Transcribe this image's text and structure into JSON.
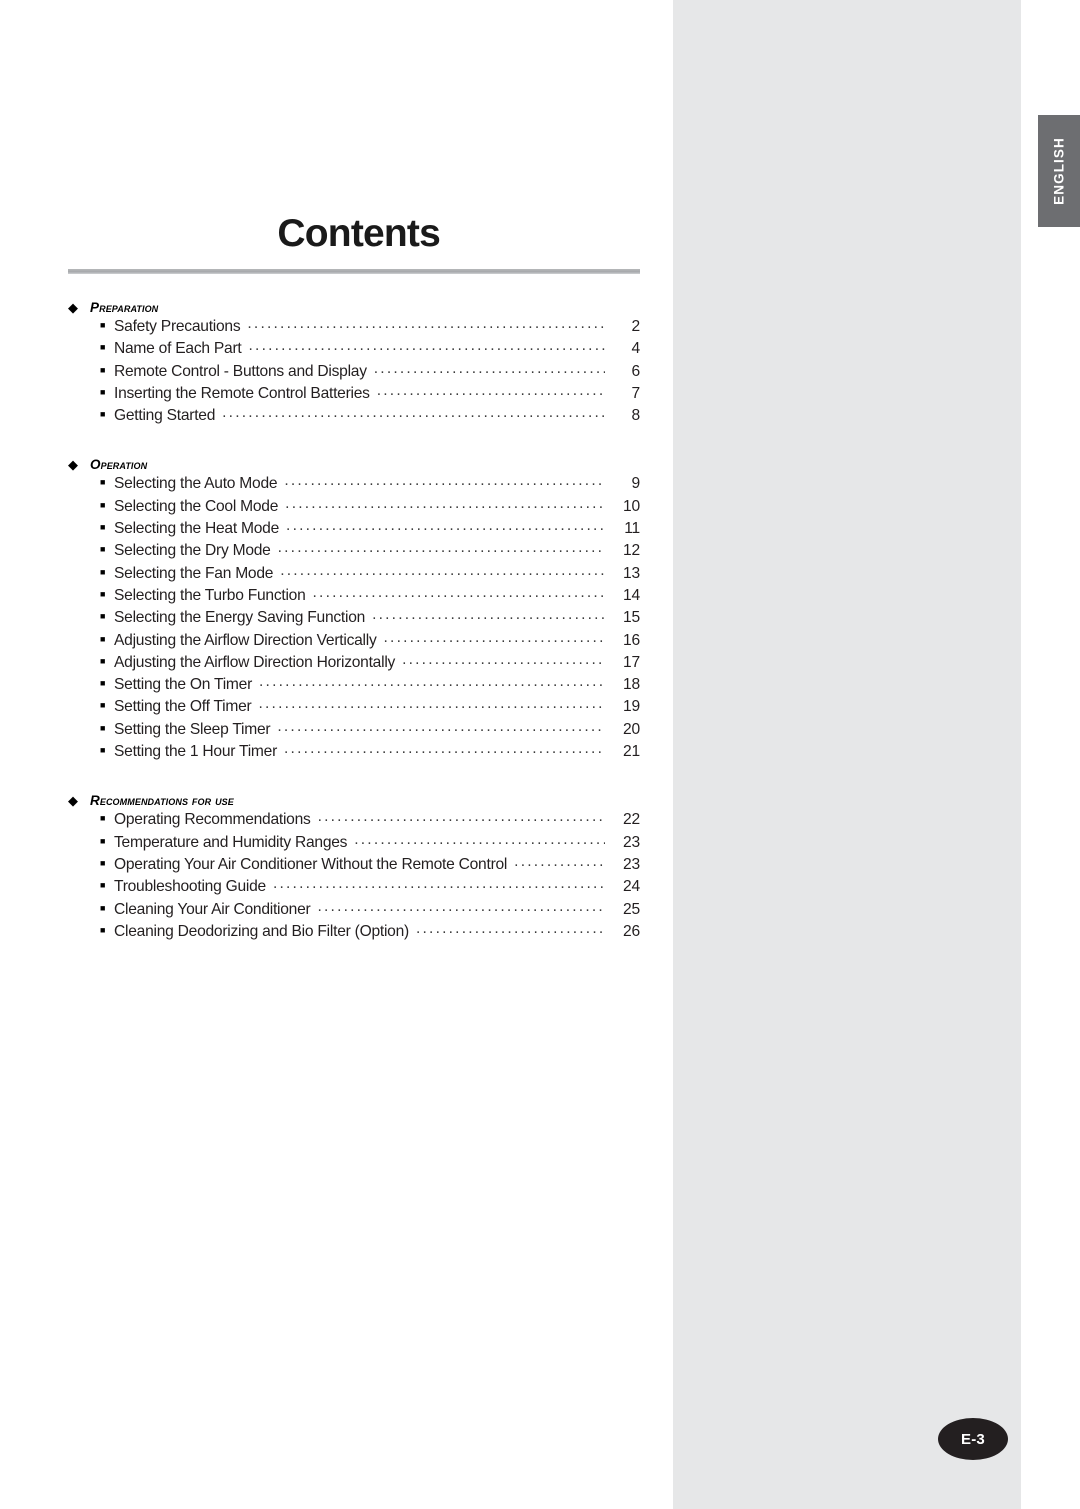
{
  "page": {
    "title": "Contents",
    "language_tab": "ENGLISH",
    "page_badge": "E-3",
    "page_badge_prefix": "E-",
    "page_badge_number": "3"
  },
  "colors": {
    "panel_gray": "#e6e7e8",
    "tab_gray": "#6d6e71",
    "badge_dark": "#231f20",
    "rule_gray": "#a7a9ac",
    "text": "#231f20"
  },
  "icons": {
    "section_bullet": "◆",
    "item_bullet": "■"
  },
  "sections": [
    {
      "heading": "Preparation",
      "items": [
        {
          "label": "Safety Precautions",
          "page": "2"
        },
        {
          "label": "Name of Each Part",
          "page": "4"
        },
        {
          "label": "Remote Control - Buttons and Display",
          "page": "6"
        },
        {
          "label": "Inserting the Remote Control Batteries",
          "page": "7"
        },
        {
          "label": "Getting Started",
          "page": "8"
        }
      ]
    },
    {
      "heading": "Operation",
      "items": [
        {
          "label": "Selecting the Auto Mode",
          "page": "9"
        },
        {
          "label": "Selecting the Cool Mode",
          "page": "10"
        },
        {
          "label": "Selecting the Heat Mode",
          "page": "11"
        },
        {
          "label": "Selecting the Dry Mode",
          "page": "12"
        },
        {
          "label": "Selecting the Fan Mode",
          "page": "13"
        },
        {
          "label": "Selecting the Turbo Function",
          "page": "14"
        },
        {
          "label": "Selecting the Energy Saving Function",
          "page": "15"
        },
        {
          "label": "Adjusting the Airflow Direction Vertically",
          "page": "16"
        },
        {
          "label": "Adjusting the Airflow Direction Horizontally",
          "page": "17"
        },
        {
          "label": "Setting the On Timer",
          "page": "18"
        },
        {
          "label": "Setting the Off Timer",
          "page": "19"
        },
        {
          "label": "Setting the Sleep Timer",
          "page": "20"
        },
        {
          "label": "Setting the 1 Hour Timer",
          "page": "21"
        }
      ]
    },
    {
      "heading": "Recommendations for use",
      "items": [
        {
          "label": "Operating Recommendations",
          "page": "22"
        },
        {
          "label": "Temperature and Humidity Ranges",
          "page": "23"
        },
        {
          "label": "Operating Your Air Conditioner Without the Remote Control",
          "page": "23"
        },
        {
          "label": "Troubleshooting Guide",
          "page": "24"
        },
        {
          "label": "Cleaning Your Air Conditioner",
          "page": "25"
        },
        {
          "label": "Cleaning Deodorizing and Bio Filter (Option)",
          "page": "26"
        }
      ]
    }
  ]
}
